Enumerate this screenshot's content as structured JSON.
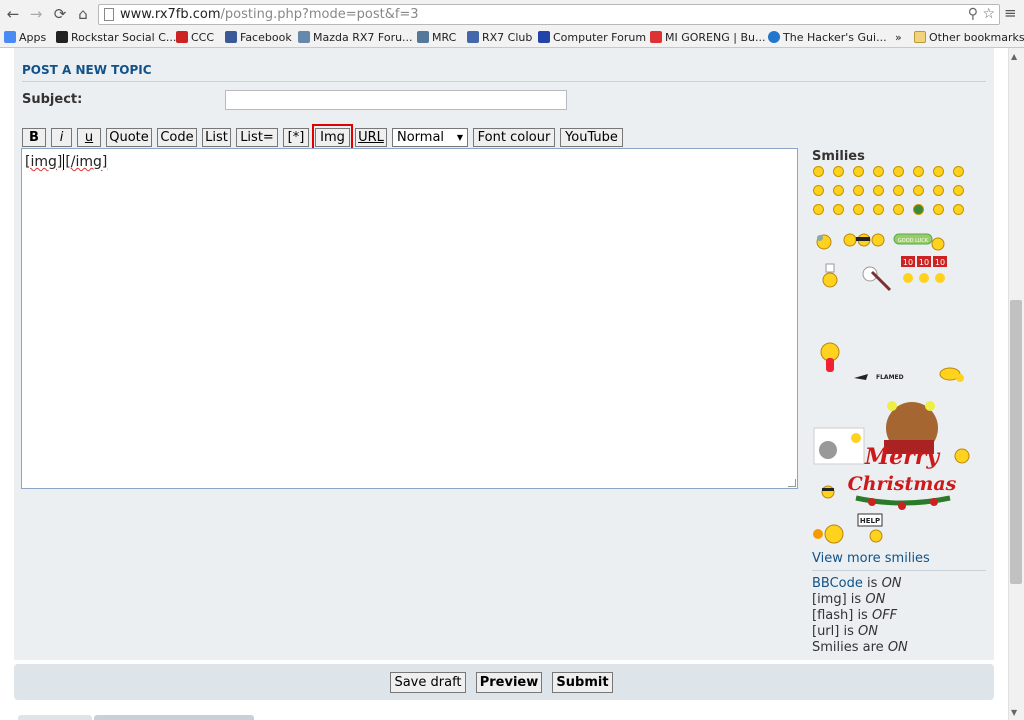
{
  "browser": {
    "url_host": "www.rx7fb.com",
    "url_path": "/posting.php?mode=post&f=3",
    "bookmarks": [
      {
        "label": "Apps",
        "color": "#4a8af4"
      },
      {
        "label": "Rockstar Social C...",
        "color": "#222222"
      },
      {
        "label": "CCC",
        "color": "#cc2222"
      },
      {
        "label": "Facebook",
        "color": "#3b5998"
      },
      {
        "label": "Mazda RX7 Foru...",
        "color": "#6688aa"
      },
      {
        "label": "MRC",
        "color": "#557799"
      },
      {
        "label": "RX7 Club",
        "color": "#4466aa"
      },
      {
        "label": "Computer Forum",
        "color": "#2244aa"
      },
      {
        "label": "MI GORENG | Bu...",
        "color": "#dd3333"
      },
      {
        "label": "The Hacker's Gui...",
        "color": "#2277cc"
      }
    ],
    "more": "»",
    "other_bookmarks": "Other bookmarks"
  },
  "form": {
    "title": "POST A NEW TOPIC",
    "subject_label": "Subject:",
    "subject_value": "",
    "toolbar": {
      "bold": "B",
      "italic": "i",
      "underline": "u",
      "quote": "Quote",
      "code": "Code",
      "list": "List",
      "list_eq": "List=",
      "list_item": "[*]",
      "img": "Img",
      "url": "URL",
      "size": "Normal",
      "font_colour": "Font colour",
      "youtube": "YouTube"
    },
    "message": {
      "open_tag": "[img]",
      "close_tag": "[/img]"
    }
  },
  "sidebar": {
    "smilies_title": "Smilies",
    "view_more": "View more smilies",
    "bbcode_link": "BBCode",
    "bbcode_is": "is",
    "bbcode_state": "ON",
    "img_status": "[img] is",
    "img_state": "ON",
    "flash_status": "[flash] is",
    "flash_state": "OFF",
    "url_status": "[url] is",
    "url_state": "ON",
    "smilies_status": "Smilies are",
    "smilies_state": "ON",
    "flamed_text": "FLAMED",
    "help_text": "HELP",
    "goodluck_text": "GOOD LUCK",
    "merry_text": "Merry",
    "christmas_text": "Christmas",
    "sign_numbers": [
      "10",
      "10",
      "10"
    ]
  },
  "actions": {
    "save_draft": "Save draft",
    "preview": "Preview",
    "submit": "Submit"
  }
}
